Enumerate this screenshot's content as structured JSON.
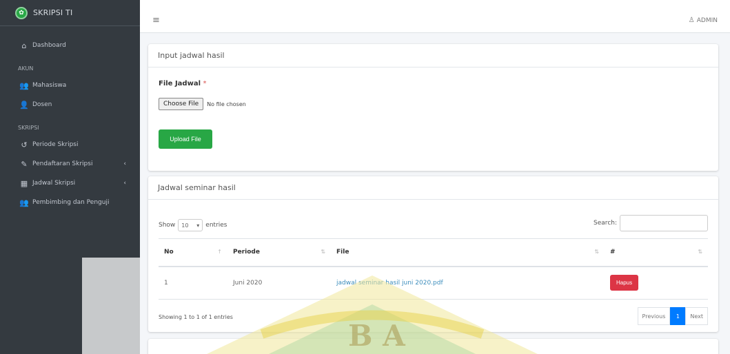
{
  "brand": {
    "name": "SKRIPSI TI"
  },
  "sidebar": {
    "dashboard": "Dashboard",
    "header_akun": "AKUN",
    "akun_items": [
      "Mahasiswa",
      "Dosen"
    ],
    "header_skripsi": "SKRIPSI",
    "skripsi_items": [
      "Periode Skripsi",
      "Pendaftaran Skripsi",
      "Jadwal Skripsi",
      "Pembimbing dan Penguji"
    ]
  },
  "topbar": {
    "user": "ADMIN"
  },
  "upload_card": {
    "title": "Input jadwal hasil",
    "file_label": "File Jadwal",
    "required_mark": "*",
    "choose_button": "Choose File",
    "no_file_text": "No file chosen",
    "upload_button": "Upload File"
  },
  "table_card": {
    "title": "Jadwal seminar hasil",
    "show_label": "Show",
    "entries_value": "10",
    "entries_label": "entries",
    "search_label": "Search:",
    "columns": [
      "No",
      "Periode",
      "File",
      "#"
    ],
    "rows": [
      {
        "no": "1",
        "periode": "Juni 2020",
        "file": "jadwal seminar hasil juni 2020.pdf",
        "action": "Hapus"
      }
    ],
    "info": "Showing 1 to 1 of 1 entries",
    "pagination": {
      "previous": "Previous",
      "current": "1",
      "next": "Next"
    }
  },
  "colors": {
    "sidebar": "#343a40",
    "primary": "#007bff",
    "success": "#28a745",
    "danger": "#dc3545"
  }
}
